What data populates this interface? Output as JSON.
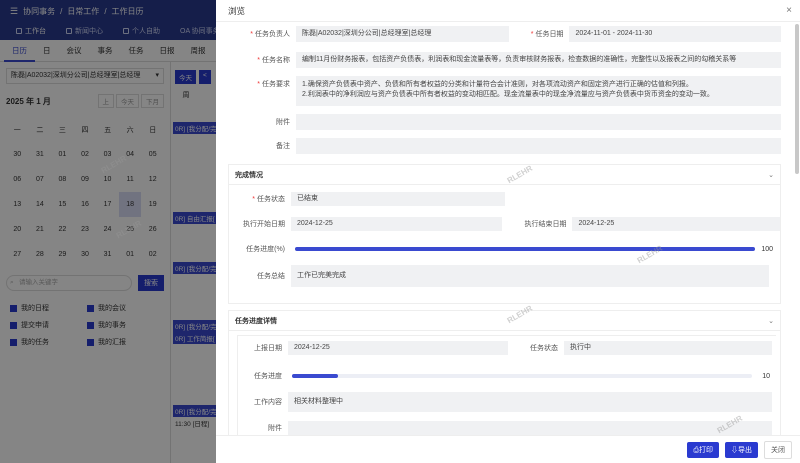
{
  "breadcrumb": [
    "协同事务",
    "日常工作",
    "工作日历"
  ],
  "top_tabs": [
    "工作台",
    "新闻中心",
    "个人自助",
    "OA 协同事务"
  ],
  "view_tabs": [
    "日历",
    "日",
    "会议",
    "事务",
    "任务",
    "日报",
    "周报"
  ],
  "org_select": "陈磊|A02032|深圳分公司|总经理室|总经理",
  "month_label": "2025 年 1 月",
  "month_buttons": [
    "上",
    "今天",
    "下月"
  ],
  "weekdays": [
    "一",
    "二",
    "三",
    "四",
    "五",
    "六",
    "日"
  ],
  "calendar_days": [
    "30",
    "31",
    "01",
    "02",
    "03",
    "04",
    "05",
    "06",
    "07",
    "08",
    "09",
    "10",
    "11",
    "12",
    "13",
    "14",
    "15",
    "16",
    "17",
    "18",
    "19",
    "20",
    "21",
    "22",
    "23",
    "24",
    "25",
    "26",
    "27",
    "28",
    "29",
    "30",
    "31",
    "01",
    "02"
  ],
  "selected_day": "18",
  "search_placeholder": "请输入关键字",
  "search_button": "搜索",
  "filters": [
    "我的日程",
    "我的会议",
    "提交申请",
    "我的事务",
    "我的任务",
    "我的汇报"
  ],
  "center_buttons": [
    "今天",
    "<"
  ],
  "center_header": "周",
  "events": [
    "0R] [我分配/完",
    "0R] 自由汇报[",
    "0R] [我分配/完",
    "0R] [我分配/完",
    "0R] 工作简报[",
    "0R] [我分配/完",
    "11:30 [日程]"
  ],
  "watermark": "RLEHR",
  "dialog": {
    "title": "浏览",
    "close_icon": "×",
    "fields": {
      "owner_label": "任务负责人",
      "owner": "陈磊|A02032|深圳分公司|总经理室|总经理",
      "date_label": "任务日期",
      "date": "2024-11-01 - 2024-11-30",
      "name_label": "任务名称",
      "name": "编制11月份财务报表，包括资产负债表，利润表和现金流量表等，负责审核财务报表，检查数据的准确性，完整性以及报表之间的勾稽关系等",
      "req_label": "任务要求",
      "req_lines": [
        "1.确保资产负债表中资产、负债和所有者权益的分类和计量符合会计准则，对各项流动资产和固定资产进行正确的估值和列报。",
        "2.利润表中的净利润应与资产负债表中所有者权益的变动相匹配。现金流量表中的现金净流量应与资产负债表中货币资金的变动一致。"
      ],
      "attach_label": "附件",
      "remark_label": "备注"
    },
    "completion": {
      "title": "完成情况",
      "status_label": "任务状态",
      "status": "已结束",
      "start_label": "执行开始日期",
      "start": "2024-12-25",
      "end_label": "执行结束日期",
      "end": "2024-12-25",
      "progress_label": "任务进度(%)",
      "progress": 100,
      "summary_label": "任务总结",
      "summary": "工作已完美完成"
    },
    "detail": {
      "title": "任务进度详情",
      "report_date_label": "上报日期",
      "report_date": "2024-12-25",
      "status_label": "任务状态",
      "status": "执行中",
      "progress_label": "任务进度",
      "progress": 10,
      "content_label": "工作内容",
      "content": "相关材料整理中",
      "attach_label": "附件"
    },
    "buttons": {
      "print": "打印",
      "export": "导出",
      "close": "关闭"
    }
  },
  "colors": {
    "primary": "#2a3ad0",
    "header": "#2a3a8f"
  }
}
